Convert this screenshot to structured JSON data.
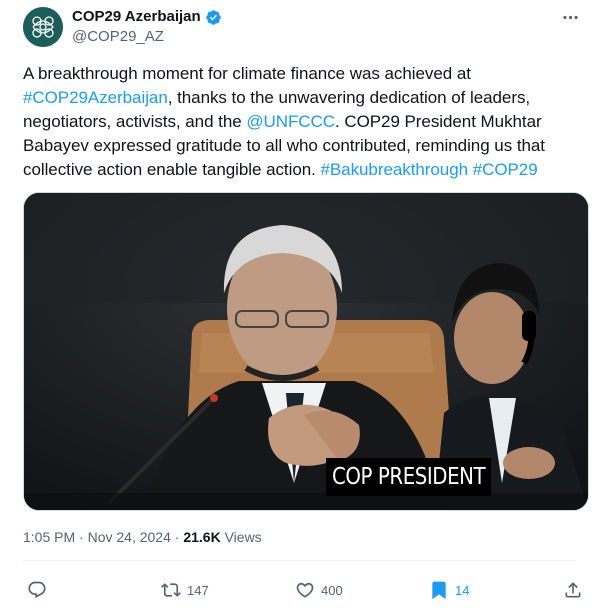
{
  "author": {
    "display_name": "COP29 Azerbaijan",
    "handle": "@COP29_AZ",
    "avatar_icon": "cop29-logo-icon",
    "verified_icon": "verified-badge-icon",
    "verified_color": "#1d9bf0"
  },
  "tweet": {
    "segments": [
      {
        "text": "A breakthrough moment for climate finance was achieved at ",
        "link": false
      },
      {
        "text": "#COP29Azerbaijan",
        "link": true
      },
      {
        "text": ", thanks to the unwavering dedication of leaders, negotiators, activists, and the ",
        "link": false
      },
      {
        "text": "@UNFCCC",
        "link": true
      },
      {
        "text": ". COP29 President Mukhtar Babayev expressed gratitude to all who contributed, reminding us that collective action enable tangible action. ",
        "link": false
      },
      {
        "text": "#Bakubreakthrough",
        "link": true
      },
      {
        "text": " ",
        "link": false
      },
      {
        "text": "#COP29",
        "link": true
      }
    ],
    "link_color": "#1d9bf0",
    "media": {
      "caption": "COP PRESIDENT"
    }
  },
  "meta": {
    "time": "1:05 PM",
    "separator": " · ",
    "date": "Nov 24, 2024",
    "views_count": "21.6K",
    "views_label": " Views"
  },
  "actions": {
    "reply": {
      "icon": "reply-icon",
      "count": ""
    },
    "repost": {
      "icon": "repost-icon",
      "count": "147"
    },
    "like": {
      "icon": "heart-icon",
      "count": "400"
    },
    "bookmark": {
      "icon": "bookmark-icon",
      "count": "14",
      "active_color": "#1d9bf0"
    },
    "share": {
      "icon": "share-icon"
    }
  },
  "more_icon": "more-options-icon"
}
